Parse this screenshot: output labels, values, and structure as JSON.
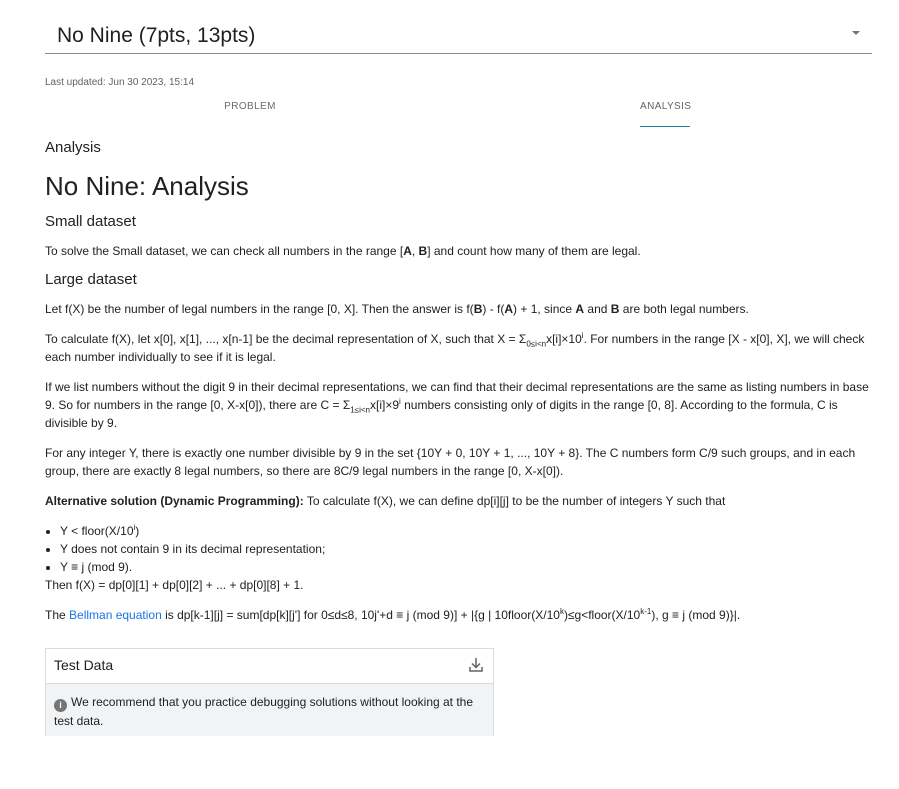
{
  "selector": {
    "value": "No Nine (7pts, 13pts)"
  },
  "meta": {
    "last_updated": "Last updated: Jun 30 2023, 15:14"
  },
  "tabs": [
    {
      "label": "PROBLEM"
    },
    {
      "label": "ANALYSIS"
    }
  ],
  "content": {
    "kicker": "Analysis",
    "title": "No Nine: Analysis",
    "small_heading": "Small dataset",
    "small_text": {
      "a": "To solve the Small dataset, we can check all numbers in the range [",
      "A": "A",
      "b": ", ",
      "B": "B",
      "c": "] and count how many of them are legal."
    },
    "large_heading": "Large dataset",
    "p1": {
      "a": "Let f(X) be the number of legal numbers in the range [0, X]. Then the answer is f(",
      "B": "B",
      "b": ") - f(",
      "A": "A",
      "c": ") + 1, since ",
      "A2": "A",
      "d": " and ",
      "B2": "B",
      "e": " are both legal numbers."
    },
    "p2": {
      "a": "To calculate f(X), let x[0], x[1], ..., x[n-1] be the decimal representation of X, such that X = Σ",
      "sub": "0≤i<n",
      "b": "x[i]×10",
      "sup": "i",
      "c": ". For numbers in the range [X - x[0], X], we will check each number individually to see if it is legal."
    },
    "p3": {
      "a": "If we list numbers without the digit 9 in their decimal representations, we can find that their decimal representations are the same as listing numbers in base 9. So for numbers in the range [0, X-x[0]), there are C = Σ",
      "sub": "1≤i<n",
      "b": "x[i]×9",
      "sup": "i",
      "c": " numbers consisting only of digits in the range [0, 8]. According to the formula, C is divisible by 9."
    },
    "p4": "For any integer Y, there is exactly one number divisible by 9 in the set {10Y + 0, 10Y + 1, ..., 10Y + 8}. The C numbers form C/9 such groups, and in each group, there are exactly 8 legal numbers, so there are 8C/9 legal numbers in the range [0, X-x[0]).",
    "p5": {
      "bold": "Alternative solution (Dynamic Programming):",
      "rest": " To calculate f(X), we can define dp[i][j] to be the number of integers Y such that"
    },
    "bullets": [
      {
        "a": "Y < floor(X/10",
        "sup": "i",
        "b": ")"
      },
      {
        "a": "Y does not contain 9 in its decimal representation;"
      },
      {
        "a": "Y ≡ j (mod 9)."
      }
    ],
    "after_bullets": "Then f(X) = dp[0][1] + dp[0][2] + ... + dp[0][8] + 1.",
    "p6": {
      "a": "The ",
      "link": "Bellman equation",
      "b": " is dp[k-1][j] = sum[dp[k][j'] for 0≤d≤8, 10j'+d ≡ j (mod 9)] + |{g | 10floor(X/10",
      "sup1": "k",
      "c": ")≤g<floor(X/10",
      "sup2": "k-1",
      "d": "), g ≡ j (mod 9)}|."
    }
  },
  "test_data": {
    "title": "Test Data",
    "icon": "download-icon",
    "notice": "We recommend that you practice debugging solutions without looking at the test data."
  }
}
